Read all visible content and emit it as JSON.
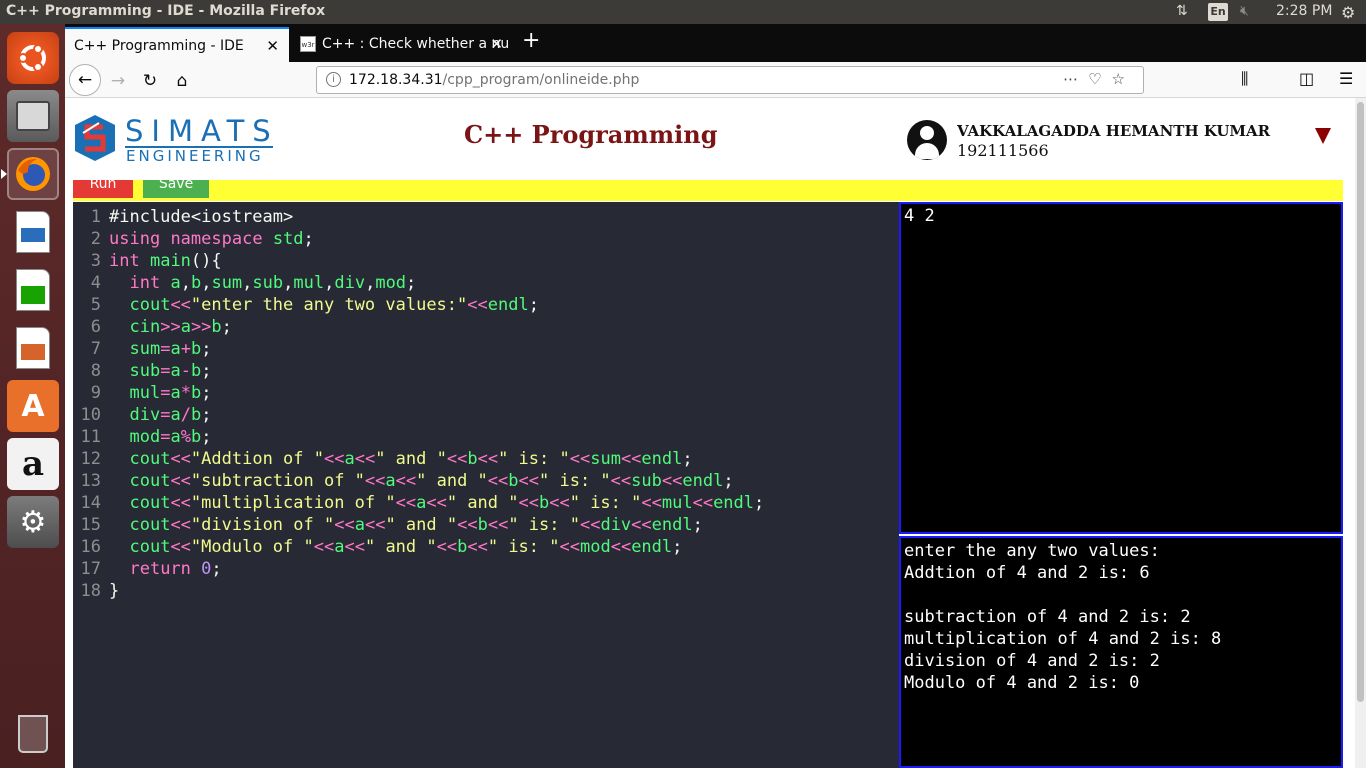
{
  "os": {
    "window_title": "C++ Programming - IDE - Mozilla Firefox",
    "language_indicator": "En",
    "clock": "2:28 PM"
  },
  "launcher": {
    "items": [
      "ubuntu-dash",
      "files",
      "firefox",
      "libreoffice-writer",
      "libreoffice-calc",
      "libreoffice-impress",
      "ubuntu-software",
      "amazon",
      "system-settings",
      "trash"
    ]
  },
  "browser": {
    "tabs": [
      {
        "label": "C++ Programming - IDE",
        "active": true
      },
      {
        "label": "C++ : Check whether a nu",
        "active": false,
        "favicon": "w3r"
      }
    ],
    "url_host": "172.18.34.31",
    "url_path": "/cpp_program/onlineide.php"
  },
  "page": {
    "logo_text": "SIMATS",
    "logo_subtext": "ENGINEERING",
    "title": "C++ Programming",
    "user_name": "VAKKALAGADDA HEMANTH KUMAR",
    "user_id": "192111566",
    "run_label": "Run",
    "save_label": "Save",
    "code_lines": [
      "#include<iostream>",
      "using namespace std;",
      "int main(){",
      "  int a,b,sum,sub,mul,div,mod;",
      "  cout<<\"enter the any two values:\"<<endl;",
      "  cin>>a>>b;",
      "  sum=a+b;",
      "  sub=a-b;",
      "  mul=a*b;",
      "  div=a/b;",
      "  mod=a%b;",
      "  cout<<\"Addtion of \"<<a<<\" and \"<<b<<\" is: \"<<sum<<endl;",
      "  cout<<\"subtraction of \"<<a<<\" and \"<<b<<\" is: \"<<sub<<endl;",
      "  cout<<\"multiplication of \"<<a<<\" and \"<<b<<\" is: \"<<mul<<endl;",
      "  cout<<\"division of \"<<a<<\" and \"<<b<<\" is: \"<<div<<endl;",
      "  cout<<\"Modulo of \"<<a<<\" and \"<<b<<\" is: \"<<mod<<endl;",
      "  return 0;",
      "}"
    ],
    "input_text": "4 2",
    "output_lines": [
      "enter the any two values:",
      "Addtion of 4 and 2 is: 6",
      "",
      "subtraction of 4 and 2 is: 2",
      "multiplication of 4 and 2 is: 8",
      "division of 4 and 2 is: 2",
      "Modulo of 4 and 2 is: 0"
    ]
  },
  "colors": {
    "title_color": "#7b1414",
    "toolbar_bg": "#ffff33",
    "run_bg": "#e53935",
    "save_bg": "#4caf50",
    "editor_bg": "#272935",
    "pane_border": "#1a1aff"
  }
}
